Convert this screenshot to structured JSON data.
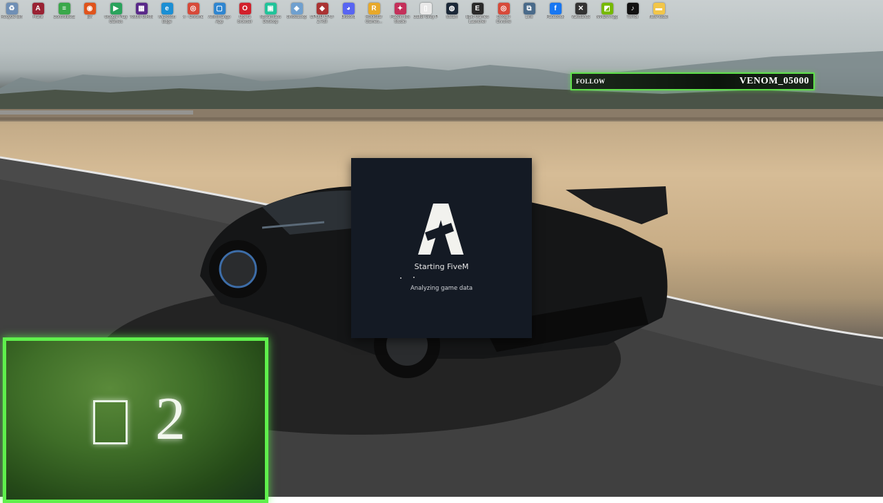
{
  "desktop": {
    "icons": [
      {
        "label": "Recycle Bin",
        "icon": "recycle-bin-icon",
        "color": "#6f8fb5",
        "glyph": "♻"
      },
      {
        "label": "Frank",
        "icon": "app-icon",
        "color": "#9a2233",
        "glyph": "A"
      },
      {
        "label": "ControlBeta",
        "icon": "app-icon",
        "color": "#3aa84a",
        "glyph": "≡"
      },
      {
        "label": "EA",
        "icon": "ea-icon",
        "color": "#e0541c",
        "glyph": "◉"
      },
      {
        "label": "Google Play Games",
        "icon": "google-play-icon",
        "color": "#2aa35c",
        "glyph": "▶"
      },
      {
        "label": "ASUS GIRIS",
        "icon": "asus-icon",
        "color": "#5a2a8a",
        "glyph": "▦"
      },
      {
        "label": "Microsoft Edge",
        "icon": "edge-icon",
        "color": "#1b8fd4",
        "glyph": "e"
      },
      {
        "label": "X - Chrome",
        "icon": "chrome-icon",
        "color": "#d74a3a",
        "glyph": "◎"
      },
      {
        "label": "Animmango App",
        "icon": "app-icon",
        "color": "#2f86d0",
        "glyph": "▢"
      },
      {
        "label": "Opera browser",
        "icon": "opera-icon",
        "color": "#d2202b",
        "glyph": "O"
      },
      {
        "label": "Streamlabs Desktop",
        "icon": "streamlabs-icon",
        "color": "#21c49a",
        "glyph": "▣"
      },
      {
        "label": "GhostLoop",
        "icon": "app-icon",
        "color": "#6fa0cf",
        "glyph": "◈"
      },
      {
        "label": "CPUID CPU-Z ASI",
        "icon": "cpuz-icon",
        "color": "#a33",
        "glyph": "◆"
      },
      {
        "label": "Discord",
        "icon": "discord-icon",
        "color": "#5865f2",
        "glyph": "◕"
      },
      {
        "label": "Rockstar Games...",
        "icon": "rockstar-icon",
        "color": "#e8a92a",
        "glyph": "R"
      },
      {
        "label": "Fadein BS Studio",
        "icon": "app-icon",
        "color": "#c4305a",
        "glyph": "✦"
      },
      {
        "label": "Caller Grey P",
        "icon": "file-icon",
        "color": "#e9e9e9",
        "glyph": "▯"
      },
      {
        "label": "Steam",
        "icon": "steam-icon",
        "color": "#1b2838",
        "glyph": "◍"
      },
      {
        "label": "Epic Games Launcher",
        "icon": "epic-icon",
        "color": "#2a2a2a",
        "glyph": "E"
      },
      {
        "label": "Google Chrome",
        "icon": "chrome-icon",
        "color": "#d74a3a",
        "glyph": "◎"
      },
      {
        "label": "Link",
        "icon": "app-icon",
        "color": "#4a6b8a",
        "glyph": "⧉"
      },
      {
        "label": "Facebook",
        "icon": "facebook-icon",
        "color": "#1877f2",
        "glyph": "f"
      },
      {
        "label": "Vakitlande",
        "icon": "app-icon",
        "color": "#333",
        "glyph": "✕"
      },
      {
        "label": "NVIDIA App",
        "icon": "nvidia-icon",
        "color": "#76b900",
        "glyph": "◩"
      },
      {
        "label": "TikTok",
        "icon": "tiktok-icon",
        "color": "#111",
        "glyph": "♪"
      },
      {
        "label": "New folder",
        "icon": "folder-icon",
        "color": "#f2c649",
        "glyph": "▬"
      }
    ]
  },
  "follow_banner": {
    "label": "FOLLOW",
    "name": "VENOM_05000"
  },
  "splash": {
    "title": "Starting FiveM",
    "status": "Analyzing game data"
  },
  "overlay": {
    "number": "2"
  }
}
